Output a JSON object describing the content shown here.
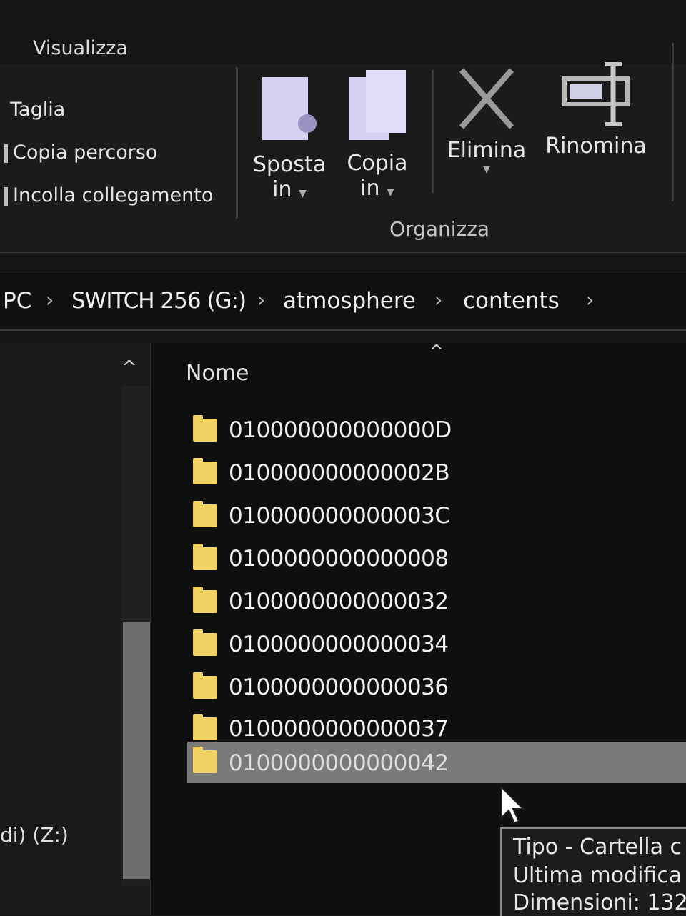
{
  "ribbon": {
    "tab_visualizza": "Visualizza",
    "clipboard": {
      "cut": "Taglia",
      "copy_path": "Copia percorso",
      "paste_shortcut": "Incolla collegamento"
    },
    "organize": {
      "move_to_line1": "Sposta",
      "move_to_line2": "in",
      "copy_to_line1": "Copia",
      "copy_to_line2": "in",
      "delete": "Elimina",
      "rename": "Rinomina",
      "group_label": "Organizza"
    }
  },
  "address_bar": {
    "crumbs": [
      "PC",
      "SWITCH 256 (G:)",
      "atmosphere",
      "contents"
    ]
  },
  "nav_pane": {
    "drive_label": "di) (Z:)"
  },
  "file_list": {
    "column_name": "Nome",
    "items": [
      {
        "name": "010000000000000D"
      },
      {
        "name": "010000000000002B"
      },
      {
        "name": "010000000000003C"
      },
      {
        "name": "0100000000000008"
      },
      {
        "name": "0100000000000032"
      },
      {
        "name": "0100000000000034"
      },
      {
        "name": "0100000000000036"
      },
      {
        "name": "0100000000000037"
      },
      {
        "name": "0100000000000042",
        "selected": true
      }
    ]
  },
  "tooltip": {
    "line1": "Tipo - Cartella c",
    "line2": "Ultima modifica",
    "line3": "Dimensioni: 132"
  },
  "colors": {
    "folder": "#f0d263",
    "selection": "#7a7a7a",
    "background": "#0f0f0f"
  }
}
